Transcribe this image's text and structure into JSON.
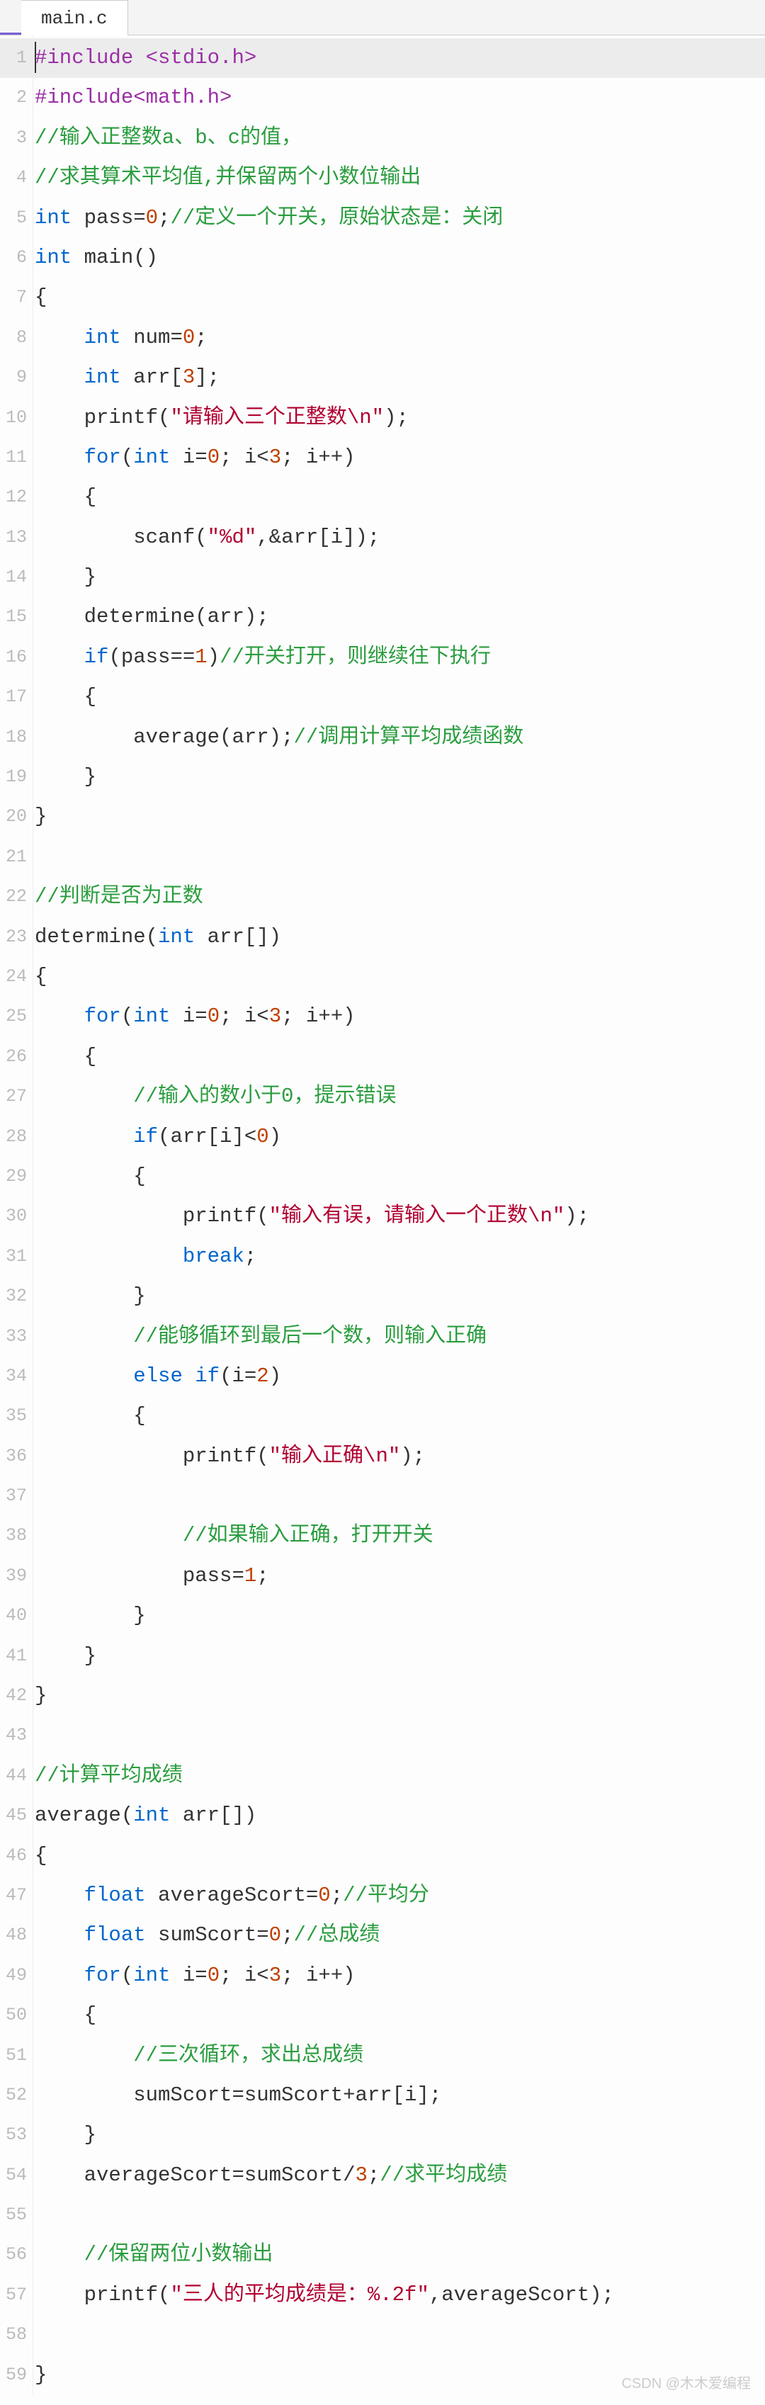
{
  "tab": {
    "filename": "main.c"
  },
  "watermark": "CSDN @木木爱编程",
  "code": {
    "lines": [
      {
        "n": 1,
        "active": true,
        "tokens": [
          {
            "c": "cursor"
          },
          {
            "c": "pp",
            "t": "#include <stdio.h>"
          }
        ]
      },
      {
        "n": 2,
        "tokens": [
          {
            "c": "pp",
            "t": "#include<math.h>"
          }
        ]
      },
      {
        "n": 3,
        "tokens": [
          {
            "c": "cm",
            "t": "//输入正整数a、b、c的值，"
          }
        ]
      },
      {
        "n": 4,
        "tokens": [
          {
            "c": "cm",
            "t": "//求其算术平均值,并保留两个小数位输出"
          }
        ]
      },
      {
        "n": 5,
        "tokens": [
          {
            "c": "kw",
            "t": "int"
          },
          {
            "t": " pass="
          },
          {
            "c": "num",
            "t": "0"
          },
          {
            "t": ";"
          },
          {
            "c": "cm",
            "t": "//定义一个开关，原始状态是：关闭"
          }
        ]
      },
      {
        "n": 6,
        "tokens": [
          {
            "c": "kw",
            "t": "int"
          },
          {
            "t": " main()"
          }
        ]
      },
      {
        "n": 7,
        "tokens": [
          {
            "t": "{"
          }
        ]
      },
      {
        "n": 8,
        "tokens": [
          {
            "t": "    "
          },
          {
            "c": "kw",
            "t": "int"
          },
          {
            "t": " num="
          },
          {
            "c": "num",
            "t": "0"
          },
          {
            "t": ";"
          }
        ]
      },
      {
        "n": 9,
        "tokens": [
          {
            "t": "    "
          },
          {
            "c": "kw",
            "t": "int"
          },
          {
            "t": " arr["
          },
          {
            "c": "num",
            "t": "3"
          },
          {
            "t": "];"
          }
        ]
      },
      {
        "n": 10,
        "tokens": [
          {
            "t": "    printf("
          },
          {
            "c": "str",
            "t": "\"请输入三个正整数\\n\""
          },
          {
            "t": ");"
          }
        ]
      },
      {
        "n": 11,
        "tokens": [
          {
            "t": "    "
          },
          {
            "c": "kw",
            "t": "for"
          },
          {
            "t": "("
          },
          {
            "c": "kw",
            "t": "int"
          },
          {
            "t": " i="
          },
          {
            "c": "num",
            "t": "0"
          },
          {
            "t": "; i<"
          },
          {
            "c": "num",
            "t": "3"
          },
          {
            "t": "; i++)"
          }
        ]
      },
      {
        "n": 12,
        "tokens": [
          {
            "t": "    {"
          }
        ]
      },
      {
        "n": 13,
        "tokens": [
          {
            "t": "        scanf("
          },
          {
            "c": "str",
            "t": "\"%d\""
          },
          {
            "t": ",&arr[i]);"
          }
        ]
      },
      {
        "n": 14,
        "tokens": [
          {
            "t": "    }"
          }
        ]
      },
      {
        "n": 15,
        "tokens": [
          {
            "t": "    determine(arr);"
          }
        ]
      },
      {
        "n": 16,
        "tokens": [
          {
            "t": "    "
          },
          {
            "c": "kw",
            "t": "if"
          },
          {
            "t": "(pass=="
          },
          {
            "c": "num",
            "t": "1"
          },
          {
            "t": ")"
          },
          {
            "c": "cm",
            "t": "//开关打开，则继续往下执行"
          }
        ]
      },
      {
        "n": 17,
        "tokens": [
          {
            "t": "    {"
          }
        ]
      },
      {
        "n": 18,
        "tokens": [
          {
            "t": "        average(arr);"
          },
          {
            "c": "cm",
            "t": "//调用计算平均成绩函数"
          }
        ]
      },
      {
        "n": 19,
        "tokens": [
          {
            "t": "    }"
          }
        ]
      },
      {
        "n": 20,
        "tokens": [
          {
            "t": "}"
          }
        ]
      },
      {
        "n": 21,
        "tokens": []
      },
      {
        "n": 22,
        "tokens": [
          {
            "c": "cm",
            "t": "//判断是否为正数"
          }
        ]
      },
      {
        "n": 23,
        "tokens": [
          {
            "t": "determine("
          },
          {
            "c": "kw",
            "t": "int"
          },
          {
            "t": " arr[])"
          }
        ]
      },
      {
        "n": 24,
        "tokens": [
          {
            "t": "{"
          }
        ]
      },
      {
        "n": 25,
        "tokens": [
          {
            "t": "    "
          },
          {
            "c": "kw",
            "t": "for"
          },
          {
            "t": "("
          },
          {
            "c": "kw",
            "t": "int"
          },
          {
            "t": " i="
          },
          {
            "c": "num",
            "t": "0"
          },
          {
            "t": "; i<"
          },
          {
            "c": "num",
            "t": "3"
          },
          {
            "t": "; i++)"
          }
        ]
      },
      {
        "n": 26,
        "tokens": [
          {
            "t": "    {"
          }
        ]
      },
      {
        "n": 27,
        "tokens": [
          {
            "t": "        "
          },
          {
            "c": "cm",
            "t": "//输入的数小于0，提示错误"
          }
        ]
      },
      {
        "n": 28,
        "tokens": [
          {
            "t": "        "
          },
          {
            "c": "kw",
            "t": "if"
          },
          {
            "t": "(arr[i]<"
          },
          {
            "c": "num",
            "t": "0"
          },
          {
            "t": ")"
          }
        ]
      },
      {
        "n": 29,
        "tokens": [
          {
            "t": "        {"
          }
        ]
      },
      {
        "n": 30,
        "tokens": [
          {
            "t": "            printf("
          },
          {
            "c": "str",
            "t": "\"输入有误，请输入一个正数\\n\""
          },
          {
            "t": ");"
          }
        ]
      },
      {
        "n": 31,
        "tokens": [
          {
            "t": "            "
          },
          {
            "c": "kw",
            "t": "break"
          },
          {
            "t": ";"
          }
        ]
      },
      {
        "n": 32,
        "tokens": [
          {
            "t": "        }"
          }
        ]
      },
      {
        "n": 33,
        "tokens": [
          {
            "t": "        "
          },
          {
            "c": "cm",
            "t": "//能够循环到最后一个数，则输入正确"
          }
        ]
      },
      {
        "n": 34,
        "tokens": [
          {
            "t": "        "
          },
          {
            "c": "kw",
            "t": "else"
          },
          {
            "t": " "
          },
          {
            "c": "kw",
            "t": "if"
          },
          {
            "t": "(i="
          },
          {
            "c": "num",
            "t": "2"
          },
          {
            "t": ")"
          }
        ]
      },
      {
        "n": 35,
        "tokens": [
          {
            "t": "        {"
          }
        ]
      },
      {
        "n": 36,
        "tokens": [
          {
            "t": "            printf("
          },
          {
            "c": "str",
            "t": "\"输入正确\\n\""
          },
          {
            "t": ");"
          }
        ]
      },
      {
        "n": 37,
        "tokens": []
      },
      {
        "n": 38,
        "tokens": [
          {
            "t": "            "
          },
          {
            "c": "cm",
            "t": "//如果输入正确，打开开关"
          }
        ]
      },
      {
        "n": 39,
        "tokens": [
          {
            "t": "            pass="
          },
          {
            "c": "num",
            "t": "1"
          },
          {
            "t": ";"
          }
        ]
      },
      {
        "n": 40,
        "tokens": [
          {
            "t": "        }"
          }
        ]
      },
      {
        "n": 41,
        "tokens": [
          {
            "t": "    }"
          }
        ]
      },
      {
        "n": 42,
        "tokens": [
          {
            "t": "}"
          }
        ]
      },
      {
        "n": 43,
        "tokens": []
      },
      {
        "n": 44,
        "tokens": [
          {
            "c": "cm",
            "t": "//计算平均成绩"
          }
        ]
      },
      {
        "n": 45,
        "tokens": [
          {
            "t": "average("
          },
          {
            "c": "kw",
            "t": "int"
          },
          {
            "t": " arr[])"
          }
        ]
      },
      {
        "n": 46,
        "tokens": [
          {
            "t": "{"
          }
        ]
      },
      {
        "n": 47,
        "tokens": [
          {
            "t": "    "
          },
          {
            "c": "kw",
            "t": "float"
          },
          {
            "t": " averageScort="
          },
          {
            "c": "num",
            "t": "0"
          },
          {
            "t": ";"
          },
          {
            "c": "cm",
            "t": "//平均分"
          }
        ]
      },
      {
        "n": 48,
        "tokens": [
          {
            "t": "    "
          },
          {
            "c": "kw",
            "t": "float"
          },
          {
            "t": " sumScort="
          },
          {
            "c": "num",
            "t": "0"
          },
          {
            "t": ";"
          },
          {
            "c": "cm",
            "t": "//总成绩"
          }
        ]
      },
      {
        "n": 49,
        "tokens": [
          {
            "t": "    "
          },
          {
            "c": "kw",
            "t": "for"
          },
          {
            "t": "("
          },
          {
            "c": "kw",
            "t": "int"
          },
          {
            "t": " i="
          },
          {
            "c": "num",
            "t": "0"
          },
          {
            "t": "; i<"
          },
          {
            "c": "num",
            "t": "3"
          },
          {
            "t": "; i++)"
          }
        ]
      },
      {
        "n": 50,
        "tokens": [
          {
            "t": "    {"
          }
        ]
      },
      {
        "n": 51,
        "tokens": [
          {
            "t": "        "
          },
          {
            "c": "cm",
            "t": "//三次循环，求出总成绩"
          }
        ]
      },
      {
        "n": 52,
        "tokens": [
          {
            "t": "        sumScort=sumScort+arr[i];"
          }
        ]
      },
      {
        "n": 53,
        "tokens": [
          {
            "t": "    }"
          }
        ]
      },
      {
        "n": 54,
        "tokens": [
          {
            "t": "    averageScort=sumScort/"
          },
          {
            "c": "num",
            "t": "3"
          },
          {
            "t": ";"
          },
          {
            "c": "cm",
            "t": "//求平均成绩"
          }
        ]
      },
      {
        "n": 55,
        "tokens": []
      },
      {
        "n": 56,
        "tokens": [
          {
            "t": "    "
          },
          {
            "c": "cm",
            "t": "//保留两位小数输出"
          }
        ]
      },
      {
        "n": 57,
        "tokens": [
          {
            "t": "    printf("
          },
          {
            "c": "str",
            "t": "\"三人的平均成绩是：%.2f\""
          },
          {
            "t": ",averageScort);"
          }
        ]
      },
      {
        "n": 58,
        "tokens": []
      },
      {
        "n": 59,
        "tokens": [
          {
            "t": "}"
          }
        ]
      }
    ]
  }
}
